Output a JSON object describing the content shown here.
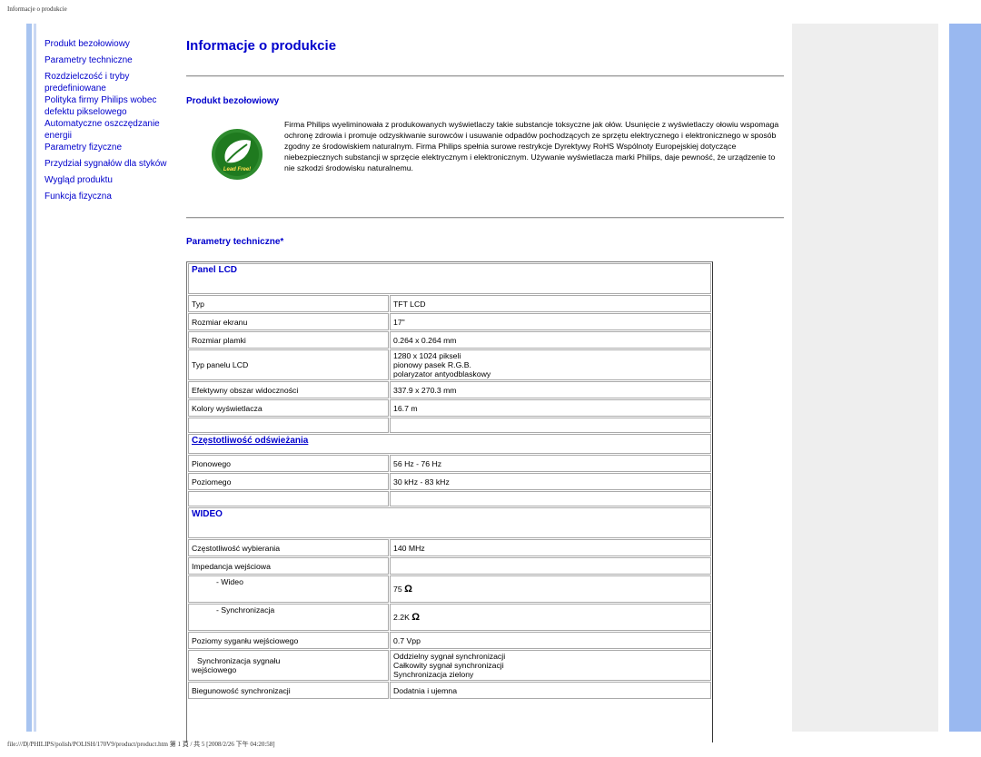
{
  "header": {
    "text": "Informacje o produkcie"
  },
  "footer": {
    "text": "file:///D|/PHILIPS/polish/POLISH/170V9/product/product.htm 第 1 頁 / 共 5 [2008/2/26 下午 04:20:58]"
  },
  "colors": {
    "link": "#0000cc",
    "left_bar": "#a8c4f0",
    "right_bar": "#99b8f0",
    "right_panel": "#eeeeee"
  },
  "sidebar": {
    "items": [
      {
        "label": "Produkt bezołowiowy"
      },
      {
        "label": "Parametry techniczne"
      },
      {
        "label": "Rozdzielczość i tryby predefiniowane"
      },
      {
        "label": "Polityka firmy Philips wobec defektu pikselowego"
      },
      {
        "label": "Automatyczne oszczędzanie energii"
      },
      {
        "label": "Parametry fizyczne"
      },
      {
        "label": "Przydział sygnałów dla styków"
      },
      {
        "label": "Wygląd produktu"
      },
      {
        "label": "Funkcja fizyczna"
      }
    ]
  },
  "main": {
    "title": "Informacje o produkcie",
    "lead_free": {
      "heading": "Produkt bezołowiowy",
      "logo_text": "Lead Free!",
      "body": "Firma Philips wyeliminowała z produkowanych wyświetlaczy takie substancje toksyczne jak ołów. Usunięcie z wyświetlaczy ołowiu wspomaga ochronę zdrowia i promuje odzyskiwanie surowców i usuwanie odpadów pochodzących ze sprzętu elektrycznego i elektronicznego w sposób zgodny ze środowiskiem naturalnym. Firma Philips spełnia surowe restrykcje Dyrektywy RoHS Wspólnoty Europejskiej dotyczące niebezpiecznych substancji w sprzęcie elektrycznym i elektronicznym. Używanie wyświetlacza marki Philips, daje pewność, że urządzenie to nie szkodzi środowisku naturalnemu."
    },
    "specs_heading": "Parametry techniczne*",
    "panel": {
      "title": "Panel LCD",
      "rows": [
        {
          "k": "Typ",
          "v": "TFT LCD"
        },
        {
          "k": "Rozmiar ekranu",
          "v": "17\""
        },
        {
          "k": "Rozmiar plamki",
          "v": "0.264 x 0.264 mm"
        },
        {
          "k": "Typ panelu LCD",
          "v1": "1280 x 1024 pikseli",
          "v2": "pionowy pasek R.G.B.",
          "v3": "polaryzator antyodblaskowy"
        },
        {
          "k": "Efektywny obszar widoczności",
          "v": "337.9 x 270.3 mm"
        },
        {
          "k": "Kolory wyświetlacza",
          "v": "16.7 m"
        }
      ]
    },
    "refresh": {
      "title": "Częstotliwość odświeżania",
      "rows": [
        {
          "k": "Pionowego",
          "v": "56 Hz - 76 Hz"
        },
        {
          "k": "Poziomego",
          "v": "30 kHz - 83 kHz"
        }
      ]
    },
    "video": {
      "title": "WIDEO",
      "rows": [
        {
          "k": "Częstotliwość wybierania",
          "v": "140 MHz"
        },
        {
          "k": "Impedancja wejściowa",
          "v": ""
        },
        {
          "k": "- Wideo",
          "v": "75",
          "unit": "Ω"
        },
        {
          "k": "- Synchronizacja",
          "v": "2.2K",
          "unit": "Ω"
        },
        {
          "k": "Poziomy syganłu wejściowego",
          "v": "0.7 Vpp"
        },
        {
          "k1": "Synchronizacja sygnału",
          "k2": "wejściowego",
          "v1": "Oddzielny sygnał synchronizacji",
          "v2": "Całkowity sygnał synchronizacji",
          "v3": "Synchronizacja zielony"
        },
        {
          "k": "Biegunowość synchronizacji",
          "v": "Dodatnia i ujemna"
        }
      ]
    }
  }
}
